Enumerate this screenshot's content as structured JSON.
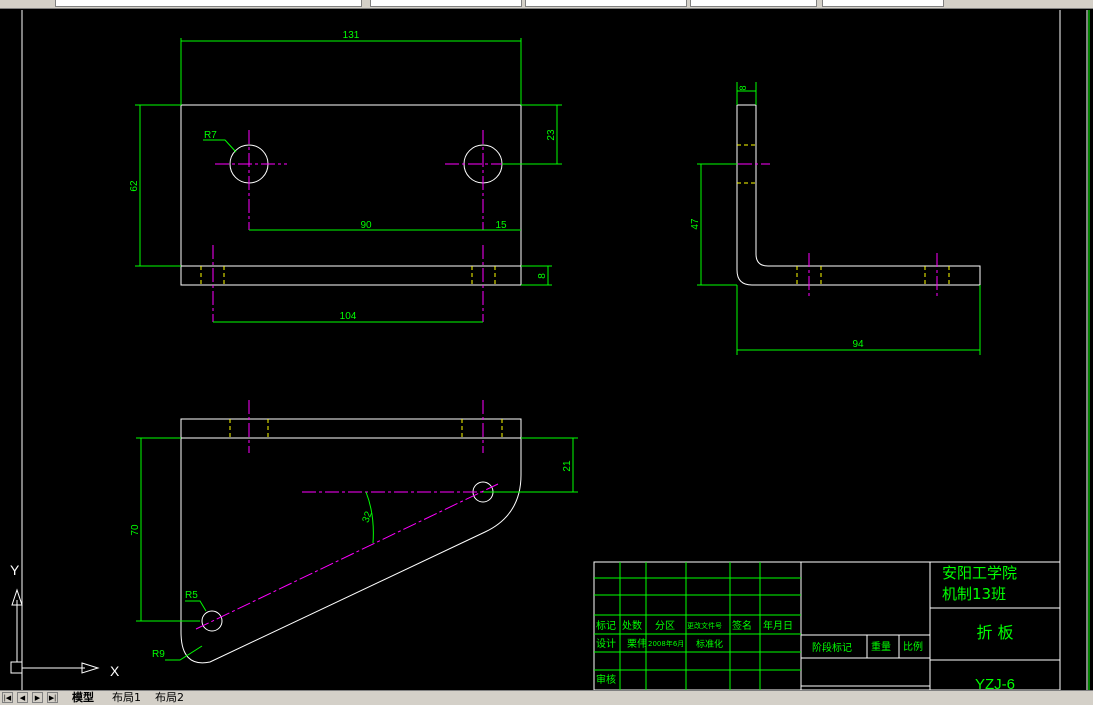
{
  "toolbar": {
    "layer_field_value": ""
  },
  "drawing": {
    "front_view": {
      "overall_width": "131",
      "height": "62",
      "hole_offset": "23",
      "hole_spacing": "90",
      "edge_offset": "15",
      "hole_radius": "R7",
      "thickness": "8",
      "bottom_span": "104"
    },
    "side_view": {
      "thickness": "8",
      "vertical": "47",
      "horizontal": "94"
    },
    "top_view": {
      "height": "70",
      "offset": "21",
      "angle": "32",
      "hole_radius": "R5",
      "corner_radius": "R9"
    }
  },
  "title_block": {
    "school": "安阳工学院",
    "class": "机制13班",
    "part_name": "折 板",
    "drawing_no": "YZJ-6",
    "headers": [
      "标记",
      "处数",
      "分区",
      "更改文件号",
      "签名",
      "年月日"
    ],
    "row_design": [
      "设计",
      "栗伟",
      "2008年6月",
      "标准化"
    ],
    "review": "审核",
    "stage_mark": "阶段标记",
    "weight": "重量",
    "scale": "比例"
  },
  "ucs": {
    "x": "X",
    "y": "Y"
  },
  "tabs": [
    "模型",
    "布局1",
    "布局2"
  ],
  "colors": {
    "background": "#000000",
    "outline": "#ffffff",
    "dimension": "#00ff00",
    "center_line": "#ff00ff",
    "hidden_line": "#ffff00",
    "title_text": "#00ff00"
  }
}
